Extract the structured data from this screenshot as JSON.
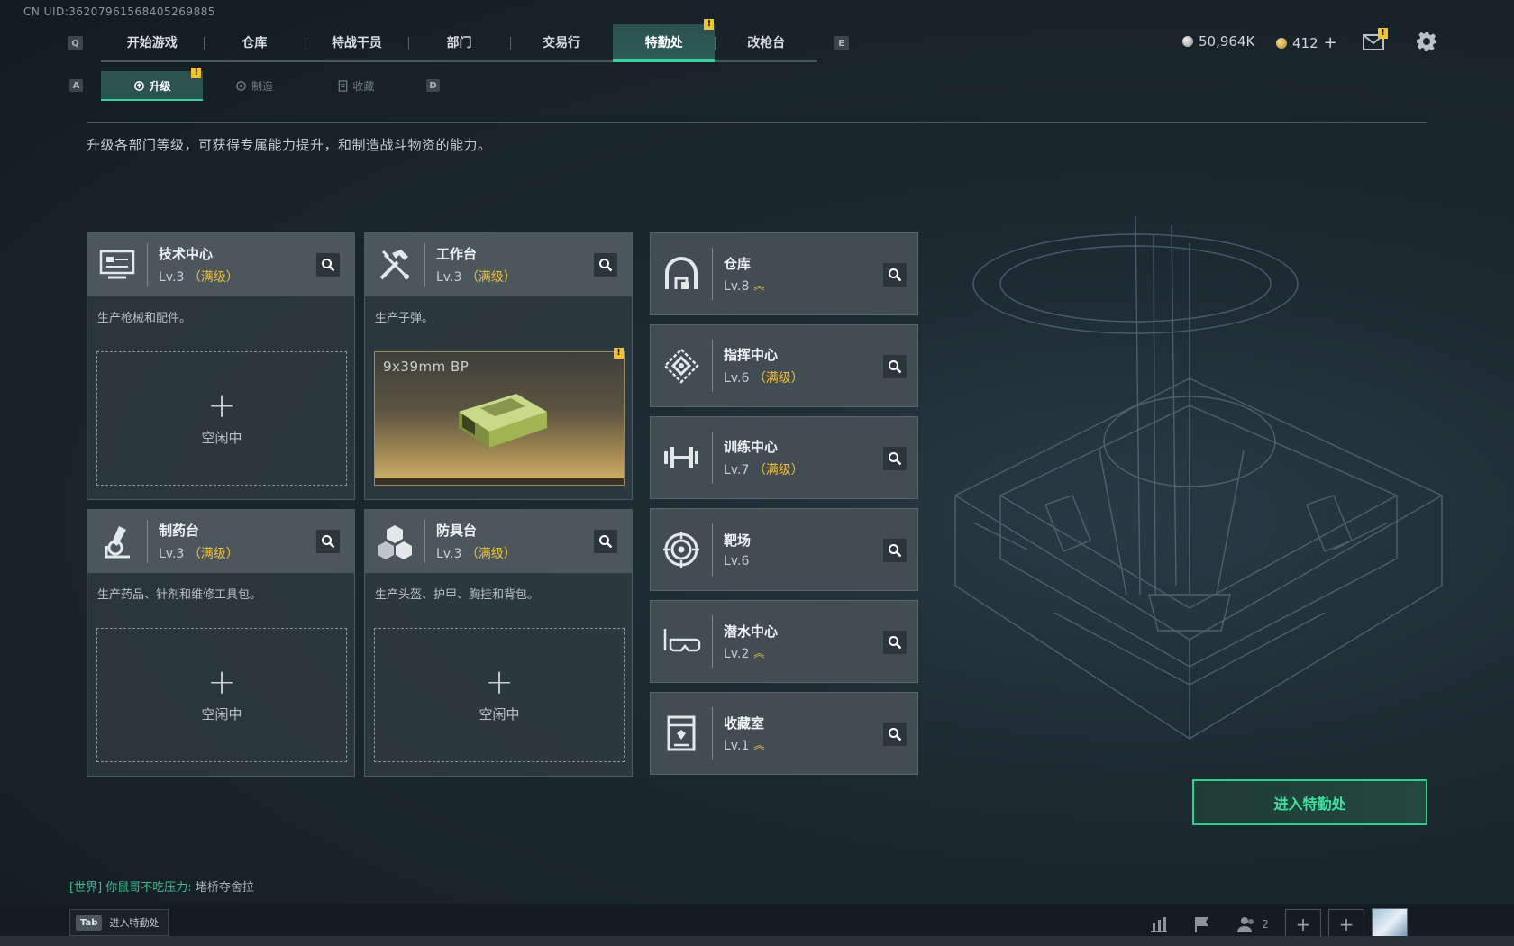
{
  "uid": "CN UID:36207961568405269885",
  "top_nav": {
    "prev_key": "Q",
    "next_key": "E",
    "tabs": [
      {
        "label": "开始游戏"
      },
      {
        "label": "仓库"
      },
      {
        "label": "特战干员"
      },
      {
        "label": "部门"
      },
      {
        "label": "交易行"
      },
      {
        "label": "特勤处",
        "active": true,
        "badge": "!"
      },
      {
        "label": "改枪台"
      }
    ]
  },
  "currency": {
    "silver": "50,964K",
    "gold": "412",
    "gold_add": "+",
    "mail_badge": "!"
  },
  "sub_nav": {
    "prev_key": "A",
    "next_key": "D",
    "tabs": [
      {
        "label": "升级",
        "active": true,
        "badge": "!"
      },
      {
        "label": "制造"
      },
      {
        "label": "收藏"
      }
    ]
  },
  "description": "升级各部门等级，可获得专属能力提升，和制造战斗物资的能力。",
  "facilities_main": [
    {
      "name": "技术中心",
      "level": "Lv.3",
      "status": "（满级）",
      "subtitle": "生产枪械和配件。",
      "slot_plus": "+",
      "slot_text": "空闲中",
      "icon": "tech-center-icon"
    },
    {
      "name": "工作台",
      "level": "Lv.3",
      "status": "（满级）",
      "subtitle": "生产子弹。",
      "craft_item": "9x39mm BP",
      "craft_badge": "!",
      "icon": "workbench-icon"
    },
    {
      "name": "制药台",
      "level": "Lv.3",
      "status": "（满级）",
      "subtitle": "生产药品、针剂和维修工具包。",
      "slot_plus": "+",
      "slot_text": "空闲中",
      "icon": "pharmacy-icon"
    },
    {
      "name": "防具台",
      "level": "Lv.3",
      "status": "（满级）",
      "subtitle": "生产头盔、护甲、胸挂和背包。",
      "slot_plus": "+",
      "slot_text": "空闲中",
      "icon": "armor-bench-icon"
    }
  ],
  "facilities_side": [
    {
      "name": "仓库",
      "level": "Lv.8",
      "status": "",
      "upgradable": true,
      "icon": "warehouse-icon"
    },
    {
      "name": "指挥中心",
      "level": "Lv.6",
      "status": "（满级）",
      "upgradable": false,
      "icon": "command-center-icon"
    },
    {
      "name": "训练中心",
      "level": "Lv.7",
      "status": "（满级）",
      "upgradable": false,
      "icon": "training-center-icon"
    },
    {
      "name": "靶场",
      "level": "Lv.6",
      "status": "",
      "upgradable": false,
      "icon": "shooting-range-icon"
    },
    {
      "name": "潜水中心",
      "level": "Lv.2",
      "status": "",
      "upgradable": true,
      "icon": "diving-center-icon"
    },
    {
      "name": "收藏室",
      "level": "Lv.1",
      "status": "",
      "upgradable": true,
      "icon": "collection-room-icon"
    }
  ],
  "enter_button": "进入特勤处",
  "chat": {
    "channel": "[世界]",
    "sender": "你鼠哥不吃压力:",
    "message": " 堵桥夺舍拉"
  },
  "bottom": {
    "tab_key": "Tab",
    "tab_label": "进入特勤处",
    "friends_count": "2"
  },
  "colors": {
    "accent_green": "#35d39b",
    "maxed_gold": "#f0c13a",
    "badge_yellow": "#f1c232"
  }
}
